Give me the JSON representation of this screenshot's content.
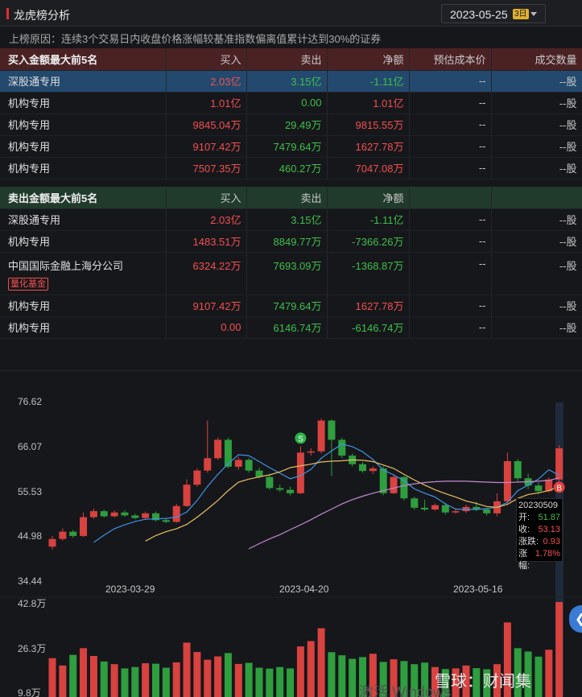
{
  "header": {
    "title": "龙虎榜分析",
    "date": "2023-05-25",
    "weekday_badge": "3日"
  },
  "reason": "上榜原因：连续3个交易日内收盘价格涨幅较基准指数偏离值累计达到30%的证券",
  "buy_table": {
    "headers": [
      "买入金额最大前5名",
      "买入",
      "卖出",
      "净额",
      "预估成本价",
      "成交数量"
    ],
    "rows": [
      {
        "name": "深股通专用",
        "buy": "2.03亿",
        "sell": "3.15亿",
        "net": "-1.11亿",
        "cost": "--",
        "qty": "--股",
        "selected": true
      },
      {
        "name": "机构专用",
        "buy": "1.01亿",
        "sell": "0.00",
        "net": "1.01亿",
        "cost": "--",
        "qty": "--股"
      },
      {
        "name": "机构专用",
        "buy": "9845.04万",
        "sell": "29.49万",
        "net": "9815.55万",
        "cost": "--",
        "qty": "--股"
      },
      {
        "name": "机构专用",
        "buy": "9107.42万",
        "sell": "7479.64万",
        "net": "1627.78万",
        "cost": "--",
        "qty": "--股"
      },
      {
        "name": "机构专用",
        "buy": "7507.35万",
        "sell": "460.27万",
        "net": "7047.08万",
        "cost": "--",
        "qty": "--股"
      }
    ]
  },
  "sell_table": {
    "headers": [
      "卖出金额最大前5名",
      "买入",
      "卖出",
      "净额",
      "",
      ""
    ],
    "rows": [
      {
        "name": "深股通专用",
        "buy": "2.03亿",
        "sell": "3.15亿",
        "net": "-1.11亿",
        "cost": "--",
        "qty": "--股"
      },
      {
        "name": "机构专用",
        "buy": "1483.51万",
        "sell": "8849.77万",
        "net": "-7366.26万",
        "cost": "--",
        "qty": "--股"
      },
      {
        "name": "中国国际金融上海分公司",
        "tag": "量化基金",
        "buy": "6324.22万",
        "sell": "7693.09万",
        "net": "-1368.87万",
        "cost": "--",
        "qty": "--股"
      },
      {
        "name": "机构专用",
        "buy": "9107.42万",
        "sell": "7479.64万",
        "net": "1627.78万",
        "cost": "--",
        "qty": "--股"
      },
      {
        "name": "机构专用",
        "buy": "0.00",
        "sell": "6146.74万",
        "net": "-6146.74万",
        "cost": "--",
        "qty": "--股"
      }
    ]
  },
  "chart_data": {
    "type": "candlestick",
    "y_ticks": [
      "76.62",
      "66.07",
      "55.53",
      "44.98",
      "34.44"
    ],
    "ylim": [
      34.44,
      76.62
    ],
    "x_ticks": [
      {
        "label": "2023-03-29",
        "index": 7
      },
      {
        "label": "2023-04-20",
        "index": 21
      },
      {
        "label": "2023-05-16",
        "index": 35
      }
    ],
    "volume_ticks": [
      "42.8万",
      "26.3万",
      "9.8万"
    ],
    "volume_ylim": [
      9.8,
      42.8
    ],
    "candles": [
      [
        42.5,
        44.3,
        41.8,
        45.0
      ],
      [
        44.3,
        46.0,
        43.9,
        46.8
      ],
      [
        46.0,
        45.0,
        44.6,
        46.4
      ],
      [
        45.0,
        49.4,
        44.8,
        50.5
      ],
      [
        49.4,
        50.8,
        49.0,
        51.4
      ],
      [
        50.8,
        49.6,
        49.3,
        51.2
      ],
      [
        49.6,
        50.5,
        49.3,
        51.0
      ],
      [
        50.5,
        49.8,
        49.5,
        51.0
      ],
      [
        49.8,
        49.2,
        48.9,
        50.2
      ],
      [
        49.2,
        50.3,
        48.9,
        50.7
      ],
      [
        50.3,
        48.7,
        48.4,
        50.7
      ],
      [
        48.7,
        48.3,
        48.0,
        49.0
      ],
      [
        48.3,
        52.0,
        48.1,
        52.5
      ],
      [
        52.0,
        57.0,
        51.8,
        58.2
      ],
      [
        57.0,
        60.3,
        56.5,
        60.8
      ],
      [
        60.3,
        63.2,
        59.8,
        72.0
      ],
      [
        63.2,
        67.5,
        62.8,
        68.0
      ],
      [
        67.5,
        61.2,
        60.8,
        68.0
      ],
      [
        61.2,
        62.8,
        60.5,
        63.5
      ],
      [
        62.8,
        60.3,
        59.8,
        63.2
      ],
      [
        60.3,
        58.8,
        58.5,
        61.0
      ],
      [
        58.8,
        56.2,
        55.8,
        59.5
      ],
      [
        56.2,
        55.8,
        55.3,
        57.0
      ],
      [
        55.8,
        55.0,
        54.5,
        56.5
      ],
      [
        55.0,
        64.5,
        54.8,
        66.0
      ],
      [
        64.5,
        64.8,
        63.8,
        65.5
      ],
      [
        64.8,
        72.0,
        64.3,
        72.5
      ],
      [
        72.0,
        67.5,
        59.0,
        72.3
      ],
      [
        67.5,
        63.8,
        63.2,
        68.0
      ],
      [
        63.8,
        61.8,
        61.3,
        64.3
      ],
      [
        61.8,
        60.2,
        59.8,
        62.3
      ],
      [
        60.2,
        60.8,
        59.5,
        61.3
      ],
      [
        60.8,
        55.0,
        54.5,
        61.3
      ],
      [
        55.0,
        58.8,
        54.8,
        59.2
      ],
      [
        58.8,
        53.8,
        53.3,
        59.0
      ],
      [
        53.8,
        51.6,
        51.1,
        54.2
      ],
      [
        51.6,
        51.2,
        50.8,
        53.5
      ],
      [
        51.2,
        52.2,
        50.9,
        52.6
      ],
      [
        52.2,
        50.5,
        50.0,
        52.8
      ],
      [
        50.5,
        50.8,
        50.2,
        51.4
      ],
      [
        50.8,
        51.8,
        50.4,
        52.3
      ],
      [
        51.8,
        51.2,
        50.8,
        53.0
      ],
      [
        51.2,
        50.3,
        49.8,
        51.6
      ],
      [
        50.3,
        53.1,
        49.6,
        55.0
      ],
      [
        53.1,
        62.5,
        52.6,
        64.5
      ],
      [
        62.5,
        58.5,
        57.8,
        63.0
      ],
      [
        58.5,
        56.8,
        56.0,
        59.6
      ],
      [
        56.8,
        55.5,
        54.8,
        57.5
      ],
      [
        55.5,
        58.2,
        55.2,
        58.7
      ],
      [
        58.2,
        65.5,
        57.8,
        66.2
      ]
    ],
    "ma": [
      {
        "color": "#3f93e6",
        "values": [
          null,
          null,
          null,
          null,
          43.5,
          45.2,
          46.7,
          47.6,
          48.4,
          48.9,
          49.0,
          49.1,
          49.4,
          50.6,
          53.3,
          56.6,
          59.4,
          61.9,
          64.0,
          63.8,
          62.4,
          61.0,
          59.7,
          58.4,
          59.1,
          60.6,
          63.2,
          64.9,
          66.5,
          65.9,
          64.7,
          62.9,
          60.4,
          59.3,
          57.9,
          56.0,
          55.0,
          54.1,
          52.5,
          51.3,
          51.2,
          51.2,
          51.4,
          51.7,
          52.9,
          55.6,
          56.9,
          58.3,
          60.5,
          59.2
        ]
      },
      {
        "color": "#e8c060",
        "values": [
          null,
          null,
          null,
          null,
          null,
          null,
          null,
          null,
          null,
          43.8,
          45.1,
          46.0,
          46.7,
          47.7,
          49.4,
          51.3,
          53.3,
          55.6,
          57.6,
          58.3,
          58.8,
          59.3,
          60.0,
          61.0,
          61.4,
          61.8,
          62.3,
          62.5,
          62.6,
          62.8,
          62.7,
          62.4,
          61.6,
          60.8,
          59.4,
          58.1,
          56.9,
          55.8,
          54.9,
          54.1,
          53.2,
          52.6,
          51.9,
          51.7,
          52.4,
          53.8,
          54.7,
          55.1,
          55.6,
          56.6
        ]
      },
      {
        "color": "#c08ad0",
        "values": [
          null,
          null,
          null,
          null,
          null,
          null,
          null,
          null,
          null,
          null,
          null,
          null,
          null,
          null,
          null,
          null,
          null,
          null,
          null,
          42.0,
          43.2,
          44.3,
          45.3,
          46.5,
          47.6,
          48.8,
          50.1,
          51.3,
          52.5,
          53.5,
          54.3,
          55.0,
          55.6,
          56.2,
          56.8,
          57.2,
          57.5,
          57.7,
          57.8,
          57.8,
          57.8,
          57.7,
          57.6,
          57.5,
          57.5,
          57.6,
          57.7,
          57.8,
          58.0,
          58.6
        ]
      }
    ],
    "volumes": [
      17.5,
      14.2,
      19.0,
      22.0,
      18.5,
      16.0,
      14.8,
      12.9,
      13.5,
      15.2,
      15.0,
      13.2,
      15.6,
      24.5,
      20.3,
      16.8,
      18.3,
      19.8,
      14.9,
      15.4,
      13.2,
      12.8,
      13.5,
      12.9,
      22.8,
      25.2,
      31.0,
      20.2,
      18.8,
      17.2,
      18.0,
      19.5,
      15.8,
      17.0,
      16.2,
      14.8,
      15.5,
      13.5,
      12.6,
      12.9,
      14.2,
      13.0,
      12.5,
      14.8,
      33.6,
      22.0,
      20.5,
      18.2,
      21.3,
      42.8
    ],
    "markers": [
      {
        "label": "S",
        "index": 24,
        "color": "#2fb34a"
      },
      {
        "label": "B",
        "index": 49,
        "color": "#e63e3e"
      }
    ],
    "tooltip": {
      "date": "20230509",
      "rows": [
        {
          "k": "开:",
          "v": "51.87",
          "color": "#3fbf4a"
        },
        {
          "k": "收:",
          "v": "53.13",
          "color": "#f24f4f"
        },
        {
          "k": "涨跌:",
          "v": "0.93",
          "color": "#f24f4f"
        },
        {
          "k": "涨幅:",
          "v": "1.78%",
          "color": "#f24f4f"
        }
      ]
    }
  },
  "watermark": "雪球：财闻集",
  "windows_watermark": "激活 Windows"
}
